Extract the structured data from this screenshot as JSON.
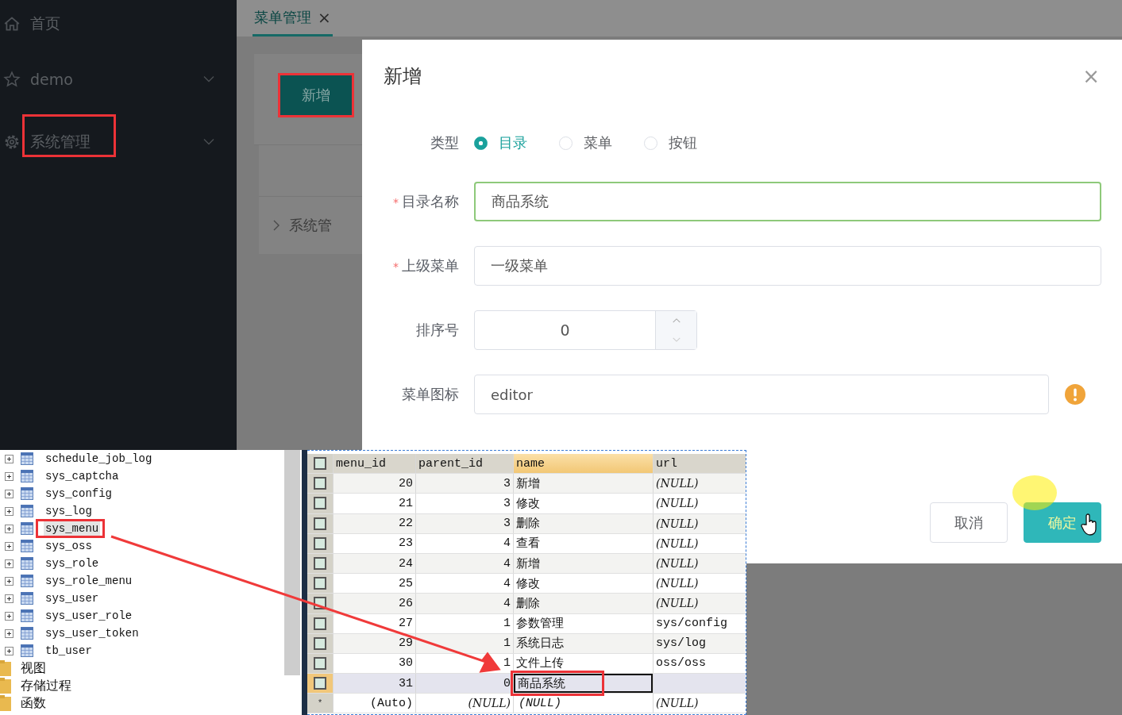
{
  "sidebar": {
    "items": [
      {
        "label": "首页",
        "has_children": false,
        "highlighted": false
      },
      {
        "label": "demo",
        "has_children": true,
        "highlighted": false
      },
      {
        "label": "系统管理",
        "has_children": true,
        "highlighted": true
      }
    ]
  },
  "tabs": [
    {
      "label": "菜单管理",
      "selected": true,
      "close": "×"
    }
  ],
  "page": {
    "add_button": {
      "label": "新增",
      "highlighted": true
    },
    "tree_row": "系统管"
  },
  "dialog": {
    "title": "新增",
    "close": "×",
    "type_label": "类型",
    "type_options": [
      {
        "label": "目录",
        "selected": true
      },
      {
        "label": "菜单",
        "selected": false
      },
      {
        "label": "按钮",
        "selected": false
      }
    ],
    "fields": [
      {
        "kind": "text",
        "label": "目录名称",
        "required": true,
        "value": "商品系统",
        "focused": true,
        "warning": false
      },
      {
        "kind": "text",
        "label": "上级菜单",
        "required": true,
        "value": "一级菜单",
        "focused": false,
        "warning": false
      },
      {
        "kind": "number",
        "label": "排序号",
        "required": false,
        "value": "0",
        "focused": false,
        "warning": false
      },
      {
        "kind": "text",
        "label": "菜单图标",
        "required": false,
        "value": "editor",
        "focused": false,
        "warning": true
      }
    ],
    "buttons": [
      {
        "label": "取消",
        "primary": false
      },
      {
        "label": "确定",
        "primary": true
      }
    ]
  },
  "db_tree": {
    "tables": [
      {
        "name": "schedule_job_log",
        "selected": false,
        "highlighted": false
      },
      {
        "name": "sys_captcha",
        "selected": false,
        "highlighted": false
      },
      {
        "name": "sys_config",
        "selected": false,
        "highlighted": false
      },
      {
        "name": "sys_log",
        "selected": false,
        "highlighted": false
      },
      {
        "name": "sys_menu",
        "selected": true,
        "highlighted": true
      },
      {
        "name": "sys_oss",
        "selected": false,
        "highlighted": false
      },
      {
        "name": "sys_role",
        "selected": false,
        "highlighted": false
      },
      {
        "name": "sys_role_menu",
        "selected": false,
        "highlighted": false
      },
      {
        "name": "sys_user",
        "selected": false,
        "highlighted": false
      },
      {
        "name": "sys_user_role",
        "selected": false,
        "highlighted": false
      },
      {
        "name": "sys_user_token",
        "selected": false,
        "highlighted": false
      },
      {
        "name": "tb_user",
        "selected": false,
        "highlighted": false
      }
    ],
    "folders": [
      "视图",
      "存储过程",
      "函数"
    ]
  },
  "db_grid": {
    "columns": [
      "menu_id",
      "parent_id",
      "name",
      "url"
    ],
    "rows": [
      {
        "menu_id": "20",
        "parent_id": "3",
        "name": "新增",
        "url": "(NULL)",
        "url_null": true,
        "current": false
      },
      {
        "menu_id": "21",
        "parent_id": "3",
        "name": "修改",
        "url": "(NULL)",
        "url_null": true,
        "current": false
      },
      {
        "menu_id": "22",
        "parent_id": "3",
        "name": "删除",
        "url": "(NULL)",
        "url_null": true,
        "current": false
      },
      {
        "menu_id": "23",
        "parent_id": "4",
        "name": "查看",
        "url": "(NULL)",
        "url_null": true,
        "current": false
      },
      {
        "menu_id": "24",
        "parent_id": "4",
        "name": "新增",
        "url": "(NULL)",
        "url_null": true,
        "current": false
      },
      {
        "menu_id": "25",
        "parent_id": "4",
        "name": "修改",
        "url": "(NULL)",
        "url_null": true,
        "current": false
      },
      {
        "menu_id": "26",
        "parent_id": "4",
        "name": "删除",
        "url": "(NULL)",
        "url_null": true,
        "current": false
      },
      {
        "menu_id": "27",
        "parent_id": "1",
        "name": "参数管理",
        "url": "sys/config",
        "url_null": false,
        "current": false
      },
      {
        "menu_id": "29",
        "parent_id": "1",
        "name": "系统日志",
        "url": "sys/log",
        "url_null": false,
        "current": false
      },
      {
        "menu_id": "30",
        "parent_id": "1",
        "name": "文件上传",
        "url": "oss/oss",
        "url_null": false,
        "current": false
      },
      {
        "menu_id": "31",
        "parent_id": "0",
        "name": "商品系统",
        "url": "",
        "url_null": false,
        "current": true
      }
    ],
    "new_row": {
      "marker": "*",
      "menu_id": "(Auto)",
      "parent_id": "(NULL)",
      "name": "(NULL)",
      "url": "(NULL)"
    }
  }
}
